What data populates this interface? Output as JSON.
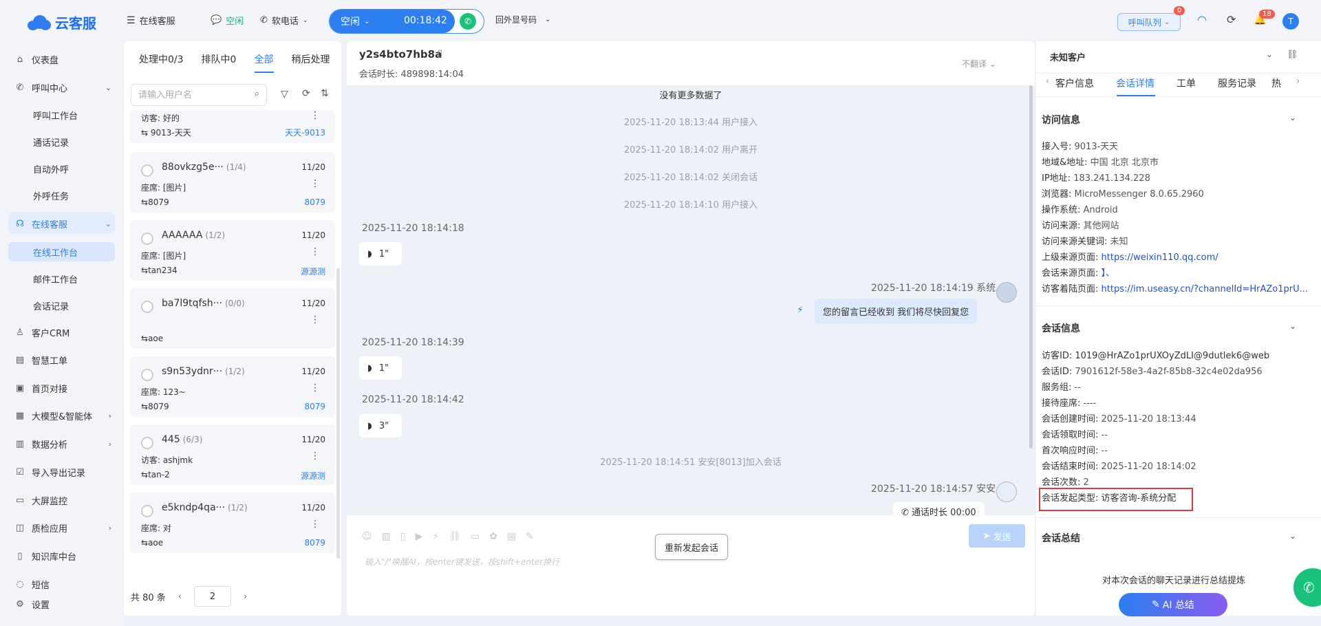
{
  "topbar": {
    "logo_text": "云客服",
    "nav_online": "在线客服",
    "status_online": "空闲",
    "soft_phone": "软电话",
    "call_status": "空闲",
    "call_timer": "00:18:42",
    "outbound_number": "回外显号码",
    "queue_label": "呼叫队列",
    "queue_badge": "0",
    "notify_badge": "18",
    "avatar_letter": "T"
  },
  "sidebar": {
    "items": [
      {
        "label": "仪表盘",
        "icon": "home-icon"
      },
      {
        "label": "呼叫中心",
        "icon": "phone-icon"
      },
      {
        "label": "呼叫工作台"
      },
      {
        "label": "通话记录"
      },
      {
        "label": "自动外呼"
      },
      {
        "label": "外呼任务"
      },
      {
        "label": "在线客服",
        "icon": "headset-icon"
      },
      {
        "label": "在线工作台"
      },
      {
        "label": "邮件工作台"
      },
      {
        "label": "会话记录"
      },
      {
        "label": "客户CRM",
        "icon": "user-icon"
      },
      {
        "label": "智慧工单",
        "icon": "ticket-icon"
      },
      {
        "label": "首页对接",
        "icon": "link-icon"
      },
      {
        "label": "大模型&智能体",
        "icon": "ai-icon"
      },
      {
        "label": "数据分析",
        "icon": "chart-icon"
      },
      {
        "label": "导入导出记录",
        "icon": "import-icon"
      },
      {
        "label": "大屏监控",
        "icon": "monitor-icon"
      },
      {
        "label": "质检应用",
        "icon": "check-icon"
      },
      {
        "label": "知识库中台",
        "icon": "book-icon"
      },
      {
        "label": "短信",
        "icon": "sms-icon"
      },
      {
        "label": "设置",
        "icon": "settings-icon"
      }
    ]
  },
  "session_list": {
    "tabs": [
      "处理中0/3",
      "排队中0",
      "全部",
      "稍后处理"
    ],
    "active_tab": "全部",
    "search_placeholder": "请输入用户名",
    "partial_card": {
      "msg": "访客: 好的",
      "agent": "9013-天天",
      "tag": "天天-9013"
    },
    "cards": [
      {
        "name": "88ovkzg5e···",
        "count": "(1/4)",
        "date": "11/20",
        "msg": "座席: [图片]",
        "agent": "8079",
        "tag": "8079"
      },
      {
        "name": "AAAAAA",
        "count": "(1/2)",
        "date": "11/20",
        "msg": "座席: [图片]",
        "agent": "tan234",
        "tag": "源源测"
      },
      {
        "name": "ba7l9tqfsh···",
        "count": "(0/0)",
        "date": "11/20",
        "msg": "",
        "agent": "aoe",
        "tag": ""
      },
      {
        "name": "s9n53ydnr···",
        "count": "(1/2)",
        "date": "11/20",
        "msg": "座席: 123~",
        "agent": "8079",
        "tag": "8079"
      },
      {
        "name": "445",
        "count": "(6/3)",
        "date": "11/20",
        "msg": "访客: ashjmk",
        "agent": "tan-2",
        "tag": "源源测"
      },
      {
        "name": "e5kndp4qa···",
        "count": "(1/2)",
        "date": "11/20",
        "msg": "座席: 对",
        "agent": "aoe",
        "tag": "8079"
      }
    ],
    "total": "共 80 条",
    "page": "2"
  },
  "chat": {
    "visitor_id": "y2s4bto7hb8a",
    "duration_label": "会话时长: 489898:14:04",
    "translate": "不翻译",
    "no_more": "没有更多数据了",
    "sys_lines": [
      "2025-11-20 18:13:44 用户接入",
      "2025-11-20 18:14:02 用户离开",
      "2025-11-20 18:14:02 关闭会话",
      "2025-11-20 18:14:10 用户接入"
    ],
    "ts1": "2025-11-20 18:14:18",
    "voice1": "1\"",
    "ts_sys": "2025-11-20 18:14:19 系统",
    "sys_msg": "您的留言已经收到 我们将尽快回复您",
    "ts2": "2025-11-20 18:14:39",
    "voice2": "1\"",
    "ts3": "2025-11-20 18:14:42",
    "voice3": "3\"",
    "join_line": "2025-11-20 18:14:51 安安[8013]加入会话",
    "ts_agent": "2025-11-20 18:14:57 安安",
    "call_msg": "通话时长 00:00",
    "input_placeholder": "输入\"/\"唤醒AI，按enter键发送，按shift+enter换行",
    "reopen": "重新发起会话",
    "send": "发送"
  },
  "right": {
    "customer": "未知客户",
    "tabs": [
      "客户信息",
      "会话详情",
      "工单",
      "服务记录",
      "热"
    ],
    "active_tab": "会话详情",
    "visit_title": "访问信息",
    "visit": [
      {
        "k": "接入号: ",
        "v": "9013-天天"
      },
      {
        "k": "地域&地址: ",
        "v": "中国 北京 北京市"
      },
      {
        "k": "IP地址: ",
        "v": "183.241.134.228"
      },
      {
        "k": "浏览器: ",
        "v": "MicroMessenger 8.0.65.2960"
      },
      {
        "k": "操作系统: ",
        "v": "Android"
      },
      {
        "k": "访问来源: ",
        "v": "其他网站"
      },
      {
        "k": "访问来源关键词: ",
        "v": "未知"
      },
      {
        "k": "上级来源页面: ",
        "v": "https://weixin110.qq.com/"
      },
      {
        "k": "会话来源页面: ",
        "v": "】、"
      },
      {
        "k": "访客着陆页面: ",
        "v": "https://im.useasy.cn/?channelId=HrAZo1prU..."
      }
    ],
    "session_title": "会话信息",
    "session": [
      {
        "k": "访客ID: ",
        "v": "1019@HrAZo1prUXOyZdLI@9dutlek6@web"
      },
      {
        "k": "会话ID: ",
        "v": "7901612f-58e3-4a2f-85b8-32c4e02da956"
      },
      {
        "k": "服务组: ",
        "v": "--"
      },
      {
        "k": "接待座席: ",
        "v": "----"
      },
      {
        "k": "会话创建时间: ",
        "v": "2025-11-20 18:13:44"
      },
      {
        "k": "会话领取时间: ",
        "v": "--"
      },
      {
        "k": "首次响应时间: ",
        "v": "--"
      },
      {
        "k": "会话结束时间: ",
        "v": "2025-11-20 18:14:02"
      },
      {
        "k": "会话次数: ",
        "v": "2"
      },
      {
        "k": "会话发起类型: ",
        "v": "访客咨询-系统分配"
      }
    ],
    "summary_title": "会话总结",
    "summary_hint": "对本次会话的聊天记录进行总结提炼",
    "ai_button": "AI 总结"
  }
}
